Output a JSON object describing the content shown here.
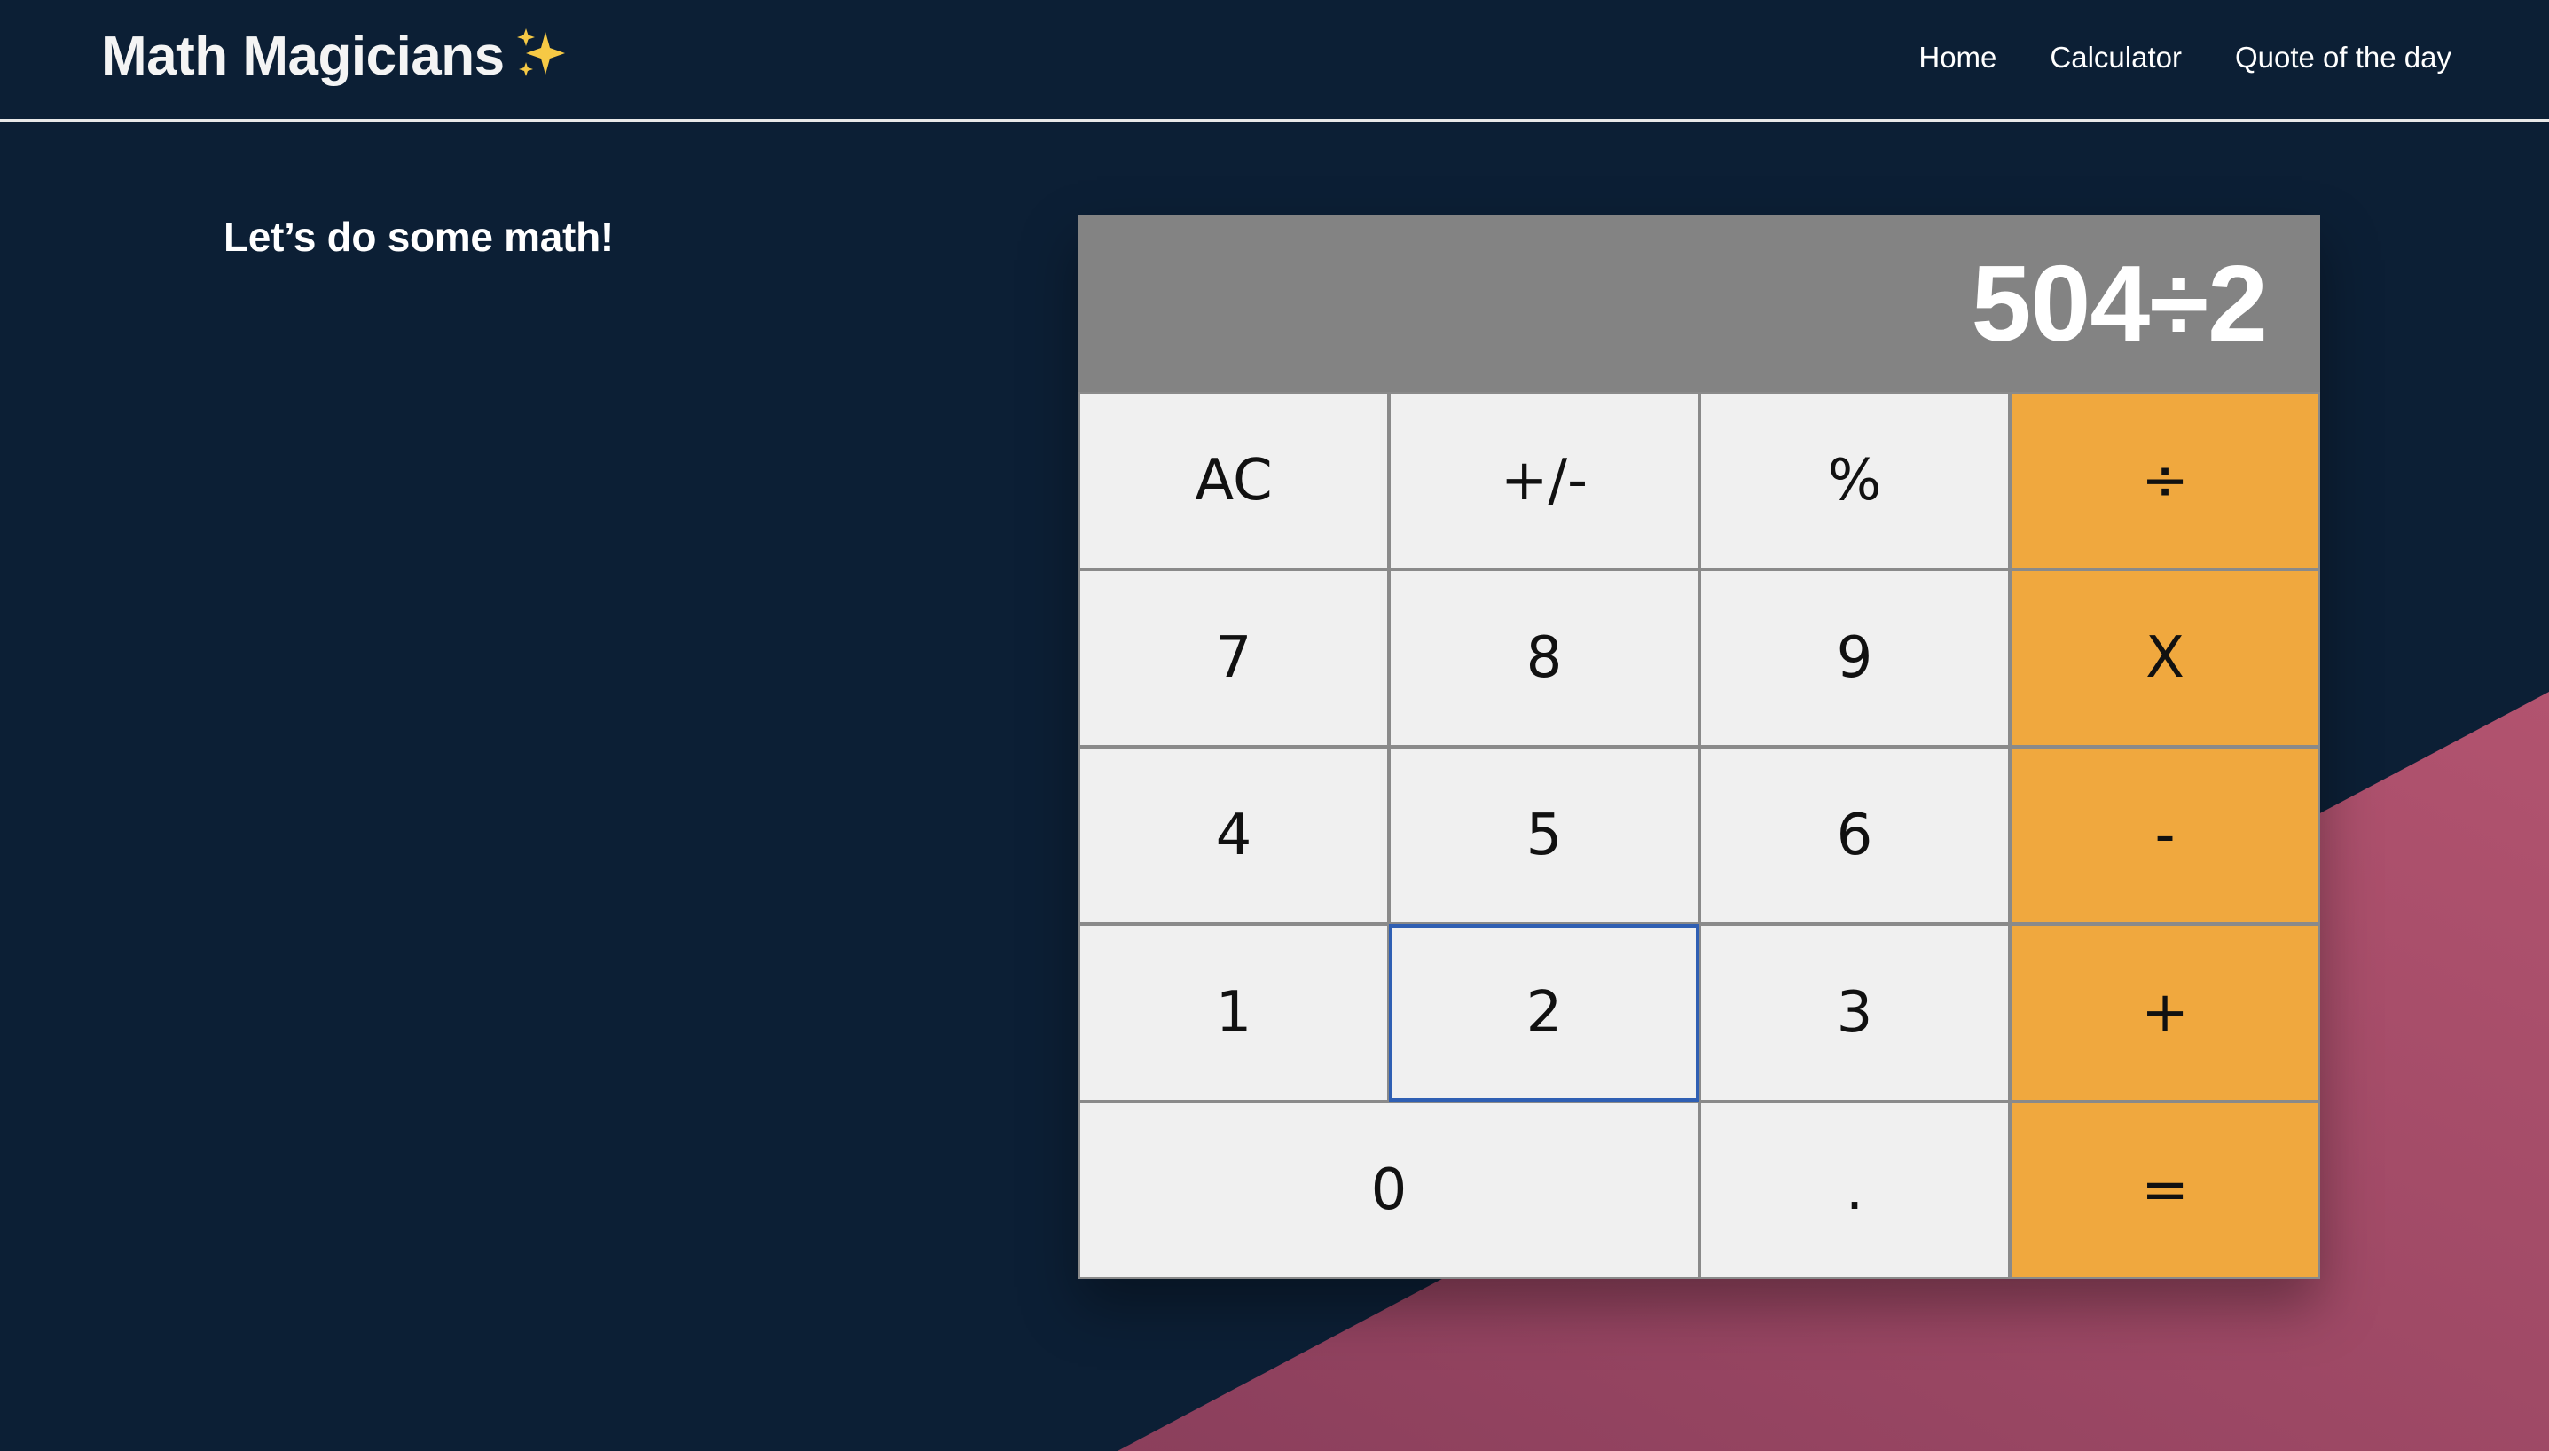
{
  "header": {
    "brand": "Math Magicians",
    "brand_icon": "sparkles-icon",
    "nav": [
      "Home",
      "Calculator",
      "Quote of the day"
    ]
  },
  "intro": "Let’s do some math!",
  "calculator": {
    "display": "504÷2",
    "keys": [
      "AC",
      "+/-",
      "%",
      "÷",
      "7",
      "8",
      "9",
      "X",
      "4",
      "5",
      "6",
      "-",
      "1",
      "2",
      "3",
      "+",
      "0",
      ".",
      "="
    ],
    "focused_key": "2"
  },
  "colors": {
    "background": "#0c1f35",
    "accent_shape": "#a8506d",
    "display_bg": "#838383",
    "key_bg": "#f0f0f0",
    "operator_bg": "#f0a83e",
    "focus_border": "#2f5fb3"
  }
}
